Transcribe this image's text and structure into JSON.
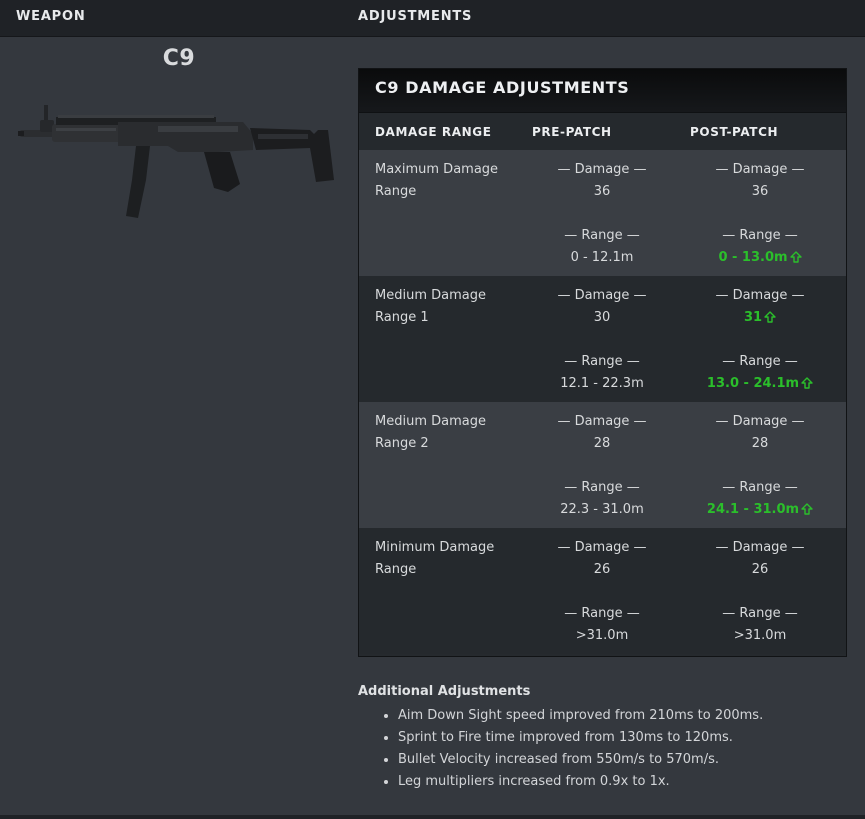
{
  "headers": {
    "weapon": "WEAPON",
    "adjustments": "ADJUSTMENTS"
  },
  "weapon": {
    "name": "C9"
  },
  "table": {
    "title": "C9 DAMAGE ADJUSTMENTS",
    "columns": [
      "DAMAGE RANGE",
      "PRE-PATCH",
      "POST-PATCH"
    ],
    "damage_label": "— Damage —",
    "range_label": "— Range —",
    "rows": [
      {
        "name": "Maximum Damage Range",
        "pre_damage": "36",
        "pre_range": "0 - 12.1m",
        "post_damage": "36",
        "post_range": "0 - 13.0m"
      },
      {
        "name": "Medium Damage Range 1",
        "pre_damage": "30",
        "pre_range": "12.1 - 22.3m",
        "post_damage": "31",
        "post_range": "13.0 - 24.1m"
      },
      {
        "name": "Medium Damage Range 2",
        "pre_damage": "28",
        "pre_range": "22.3 - 31.0m",
        "post_damage": "28",
        "post_range": "24.1 - 31.0m"
      },
      {
        "name": "Minimum Damage Range",
        "pre_damage": "26",
        "pre_range": ">31.0m",
        "post_damage": "26",
        "post_range": ">31.0m"
      }
    ]
  },
  "additional": {
    "title": "Additional Adjustments",
    "items": [
      "Aim Down Sight speed improved from 210ms to 200ms.",
      "Sprint to Fire time improved from 130ms to 120ms.",
      "Bullet Velocity increased from 550m/s to 570m/s.",
      "Leg multipliers increased from 0.9x to 1x."
    ]
  },
  "colors": {
    "background": "#34383e",
    "header_bar": "#1f2226",
    "improved": "#2bbf2b"
  },
  "icons": {
    "improvement": "up-arrow-icon"
  }
}
